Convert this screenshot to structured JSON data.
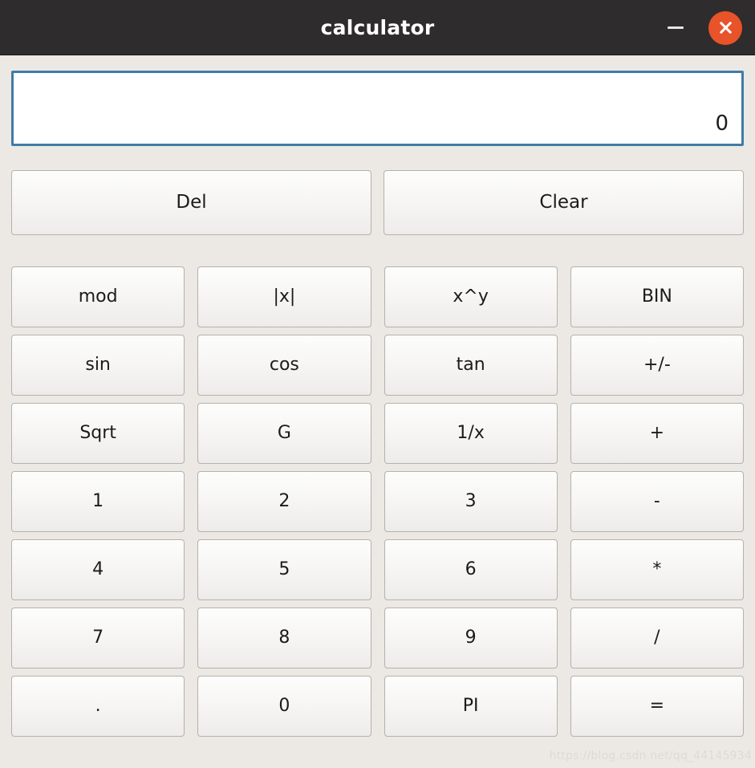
{
  "window": {
    "title": "calculator",
    "minimize_label": "–",
    "close_label": "×",
    "accent_close_color": "#e8532a",
    "titlebar_color": "#2e2c2c",
    "body_color": "#ece9e4"
  },
  "display": {
    "value": "0",
    "border_color": "#3f7ba9",
    "background": "#ffffff"
  },
  "actions": [
    {
      "label": "Del",
      "name": "del-button"
    },
    {
      "label": "Clear",
      "name": "clear-button"
    }
  ],
  "keypad": {
    "rows": [
      [
        {
          "label": "mod",
          "name": "key-mod"
        },
        {
          "label": "|x|",
          "name": "key-abs"
        },
        {
          "label": "x^y",
          "name": "key-power"
        },
        {
          "label": "BIN",
          "name": "key-bin"
        }
      ],
      [
        {
          "label": "sin",
          "name": "key-sin"
        },
        {
          "label": "cos",
          "name": "key-cos"
        },
        {
          "label": "tan",
          "name": "key-tan"
        },
        {
          "label": "+/-",
          "name": "key-sign"
        }
      ],
      [
        {
          "label": "Sqrt",
          "name": "key-sqrt"
        },
        {
          "label": "G",
          "name": "key-g"
        },
        {
          "label": "1/x",
          "name": "key-reciprocal"
        },
        {
          "label": "+",
          "name": "key-plus"
        }
      ],
      [
        {
          "label": "1",
          "name": "key-1"
        },
        {
          "label": "2",
          "name": "key-2"
        },
        {
          "label": "3",
          "name": "key-3"
        },
        {
          "label": "-",
          "name": "key-minus"
        }
      ],
      [
        {
          "label": "4",
          "name": "key-4"
        },
        {
          "label": "5",
          "name": "key-5"
        },
        {
          "label": "6",
          "name": "key-6"
        },
        {
          "label": "*",
          "name": "key-multiply"
        }
      ],
      [
        {
          "label": "7",
          "name": "key-7"
        },
        {
          "label": "8",
          "name": "key-8"
        },
        {
          "label": "9",
          "name": "key-9"
        },
        {
          "label": "/",
          "name": "key-divide"
        }
      ],
      [
        {
          "label": ".",
          "name": "key-decimal"
        },
        {
          "label": "0",
          "name": "key-0"
        },
        {
          "label": "PI",
          "name": "key-pi"
        },
        {
          "label": "=",
          "name": "key-equals"
        }
      ]
    ]
  },
  "watermark": {
    "text": "https://blog.csdn.net/qq_44145934"
  }
}
